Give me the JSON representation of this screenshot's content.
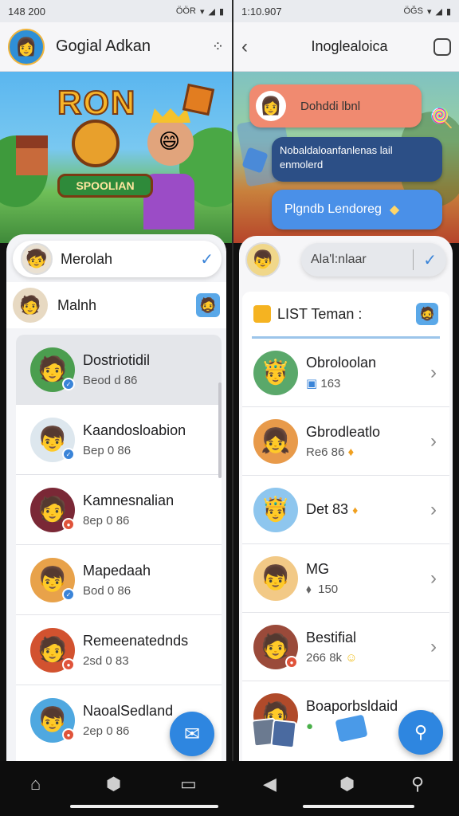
{
  "status": {
    "left_time": "148 200",
    "right_time": "1:10.907",
    "left_icons": "ÖÖR",
    "right_icons": "ÖĞS"
  },
  "left": {
    "title": "Gogial Adkan",
    "banner": {
      "logo_text": "RON",
      "ribbon_text": "SPOOLIAN"
    },
    "selected_user": "Merolah",
    "current_user": "Malnh",
    "list": [
      {
        "name": "Dostriotidil",
        "sub": "Beod d 86",
        "badge_color": "#3a84d8"
      },
      {
        "name": "Kaandosloabion",
        "sub": "Bep 0 86",
        "badge_color": "#3a84d8"
      },
      {
        "name": "Kamnesnalian",
        "sub": "8ep 0 86",
        "badge_color": "#e0533a"
      },
      {
        "name": "Mapedaah",
        "sub": "Bod 0 86",
        "badge_color": "#3a84d8"
      },
      {
        "name": "Remeenatednds",
        "sub": "2sd 0 83",
        "badge_color": "#e0533a"
      },
      {
        "name": "NaoalSedland",
        "sub": "2ep 0 86",
        "badge_color": "#e0533a"
      }
    ]
  },
  "right": {
    "title": "Inoglealoica",
    "bubbles": {
      "first": "Dohddi lbnl",
      "second": "Nobaldaloanfanlenas lail enmolerd",
      "third": "Plgndb Lendoreg"
    },
    "search_pill": "Ala'l:nlaar",
    "list_title": "LIST Teman :",
    "list": [
      {
        "name": "Obroloolan",
        "sub": "163",
        "sub_icon": "box-icon"
      },
      {
        "name": "Gbrodleatlo",
        "sub": "Re6 86",
        "sub_icon": "fire-icon"
      },
      {
        "name": "Det 83",
        "sub": "",
        "sub_icon": "fire-icon"
      },
      {
        "name": "MG",
        "sub": "150",
        "sub_icon": "pin-icon"
      },
      {
        "name": "Bestifial",
        "sub": "266 8k",
        "sub_icon": "smile-icon"
      },
      {
        "name": "Boaporbsldaid",
        "sub": "",
        "sub_icon": "dot-icon"
      }
    ]
  },
  "colors": {
    "accent": "#2e86e0",
    "card_bg": "#f3f4f7"
  }
}
